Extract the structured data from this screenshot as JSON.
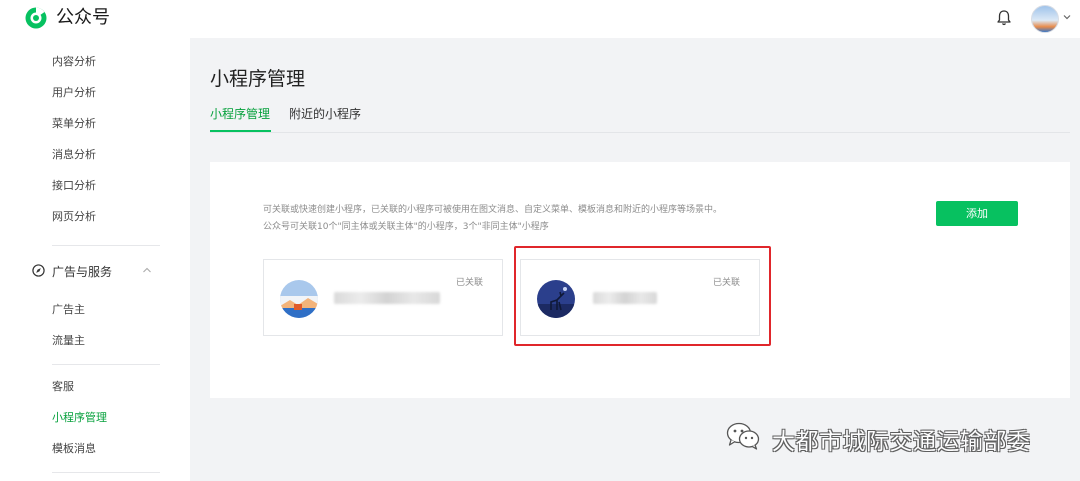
{
  "header": {
    "brand": "公众号",
    "logo_icon": "wechat-mp-logo-icon",
    "bell_icon": "bell-icon",
    "avatar_icon": "user-avatar",
    "caret_icon": "chevron-down-icon"
  },
  "sidebar": {
    "analytics_items": [
      "内容分析",
      "用户分析",
      "菜单分析",
      "消息分析",
      "接口分析",
      "网页分析"
    ],
    "section": {
      "label": "广告与服务",
      "icon": "compass-icon",
      "toggle_icon": "chevron-up-icon"
    },
    "ad_items": [
      "广告主",
      "流量主"
    ],
    "service_items": [
      "客服",
      "小程序管理",
      "模板消息"
    ],
    "active_item": "小程序管理"
  },
  "main": {
    "title": "小程序管理",
    "tabs": [
      {
        "label": "小程序管理",
        "active": true
      },
      {
        "label": "附近的小程序",
        "active": false
      }
    ],
    "description_line1": "可关联或快速创建小程序，已关联的小程序可被使用在图文消息、自定义菜单、模板消息和附近的小程序等场景中。",
    "description_line2": "公众号可关联10个\"同主体或关联主体\"的小程序，3个\"非同主体\"小程序",
    "add_button": "添加",
    "cards": [
      {
        "status": "已关联",
        "avatar": "landscape-avatar"
      },
      {
        "status": "已关联",
        "avatar": "night-deer-avatar"
      }
    ]
  },
  "watermark": {
    "text": "大都市城际交通运输部委",
    "icon": "wechat-icon"
  },
  "colors": {
    "accent": "#07c160",
    "highlight_border": "#e0262b",
    "background": "#f2f3f5"
  }
}
